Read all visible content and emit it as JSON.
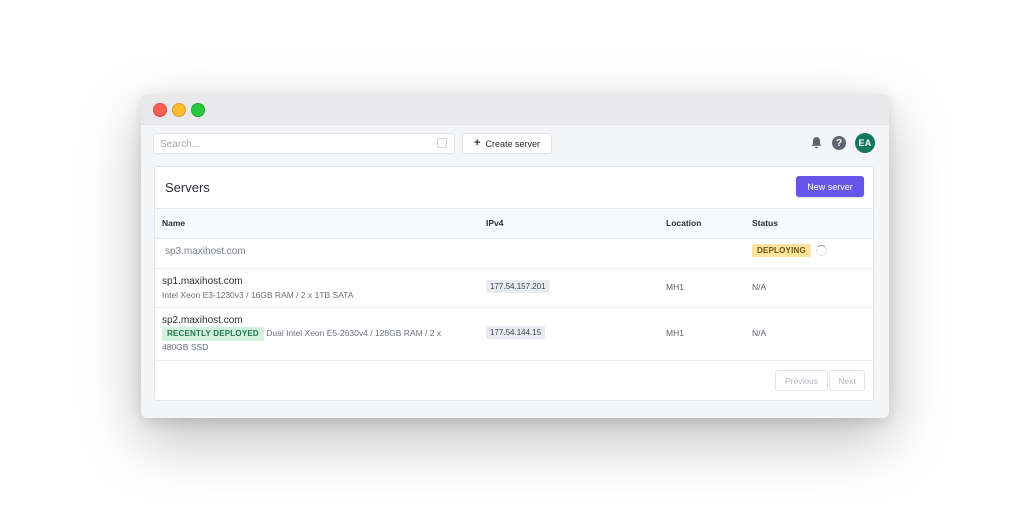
{
  "toolbar": {
    "search_placeholder": "Search...",
    "create_label": "Create server",
    "avatar_initials": "EA",
    "help_glyph": "?"
  },
  "card": {
    "title": "Servers",
    "new_server_label": "New server"
  },
  "table": {
    "columns": [
      "Name",
      "IPv4",
      "Location",
      "Status"
    ],
    "rows": [
      {
        "name": "sp3.maxihost.com",
        "status_badge": "DEPLOYING"
      },
      {
        "name": "sp1.maxihost.com",
        "spec": "Intel Xeon E3-1230v3 / 16GB RAM / 2 x 1TB SATA",
        "ipv4": "177.54.157.201",
        "location": "MH1",
        "status": "N/A"
      },
      {
        "name": "sp2.maxihost.com",
        "badge": "RECENTLY DEPLOYED",
        "spec_line1": "Dual Intel Xeon E5-2630v4 / 128GB RAM / 2 x",
        "spec_line2": "480GB SSD",
        "ipv4": "177.54.144.15",
        "location": "MH1",
        "status": "N/A"
      }
    ]
  },
  "pagination": {
    "previous": "Previous",
    "next": "Next"
  },
  "colors": {
    "primary": "#6555e8",
    "avatar": "#14785a",
    "deploying_badge": "#fde49a",
    "recent_badge": "#d4f1e0"
  }
}
